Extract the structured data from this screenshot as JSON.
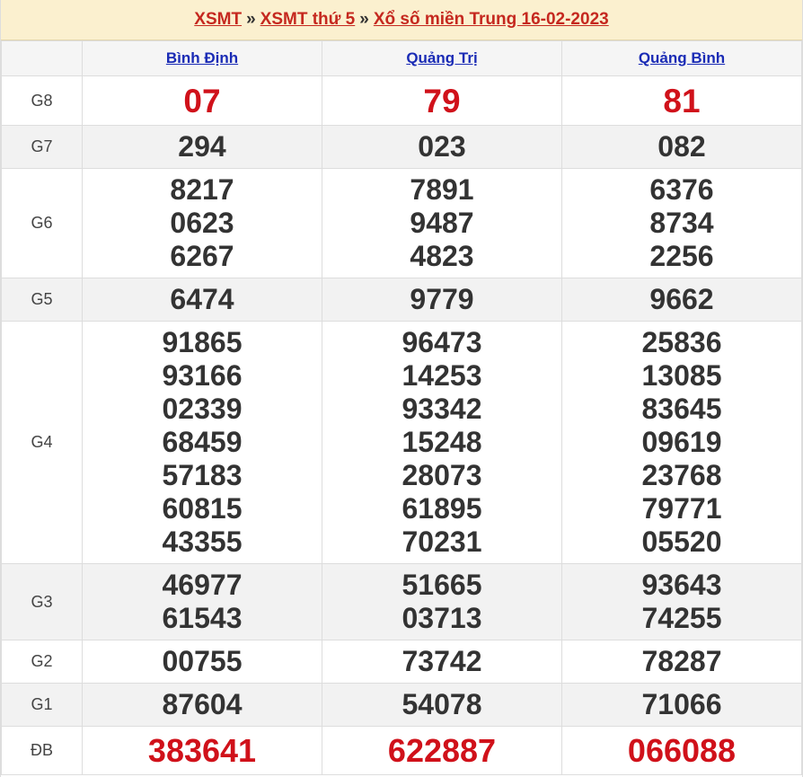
{
  "title": {
    "crumb1": "XSMT",
    "sep1": "»",
    "crumb2": "XSMT thứ 5",
    "sep2": "»",
    "crumb3": "Xổ số miền Trung 16-02-2023"
  },
  "provinces": [
    "Bình Định",
    "Quảng Trị",
    "Quảng Bình"
  ],
  "prizes": [
    {
      "label": "G8",
      "values": [
        [
          "07"
        ],
        [
          "79"
        ],
        [
          "81"
        ]
      ]
    },
    {
      "label": "G7",
      "values": [
        [
          "294"
        ],
        [
          "023"
        ],
        [
          "082"
        ]
      ]
    },
    {
      "label": "G6",
      "values": [
        [
          "8217",
          "0623",
          "6267"
        ],
        [
          "7891",
          "9487",
          "4823"
        ],
        [
          "6376",
          "8734",
          "2256"
        ]
      ]
    },
    {
      "label": "G5",
      "values": [
        [
          "6474"
        ],
        [
          "9779"
        ],
        [
          "9662"
        ]
      ]
    },
    {
      "label": "G4",
      "values": [
        [
          "91865",
          "93166",
          "02339",
          "68459",
          "57183",
          "60815",
          "43355"
        ],
        [
          "96473",
          "14253",
          "93342",
          "15248",
          "28073",
          "61895",
          "70231"
        ],
        [
          "25836",
          "13085",
          "83645",
          "09619",
          "23768",
          "79771",
          "05520"
        ]
      ]
    },
    {
      "label": "G3",
      "values": [
        [
          "46977",
          "61543"
        ],
        [
          "51665",
          "03713"
        ],
        [
          "93643",
          "74255"
        ]
      ]
    },
    {
      "label": "G2",
      "values": [
        [
          "00755"
        ],
        [
          "73742"
        ],
        [
          "78287"
        ]
      ]
    },
    {
      "label": "G1",
      "values": [
        [
          "87604"
        ],
        [
          "54078"
        ],
        [
          "71066"
        ]
      ]
    },
    {
      "label": "ĐB",
      "values": [
        [
          "383641"
        ],
        [
          "622887"
        ],
        [
          "066088"
        ]
      ]
    }
  ],
  "colors": {
    "highlight": "#d0111a",
    "link": "#1a2bb5",
    "title_bg": "#fbf0cf"
  }
}
